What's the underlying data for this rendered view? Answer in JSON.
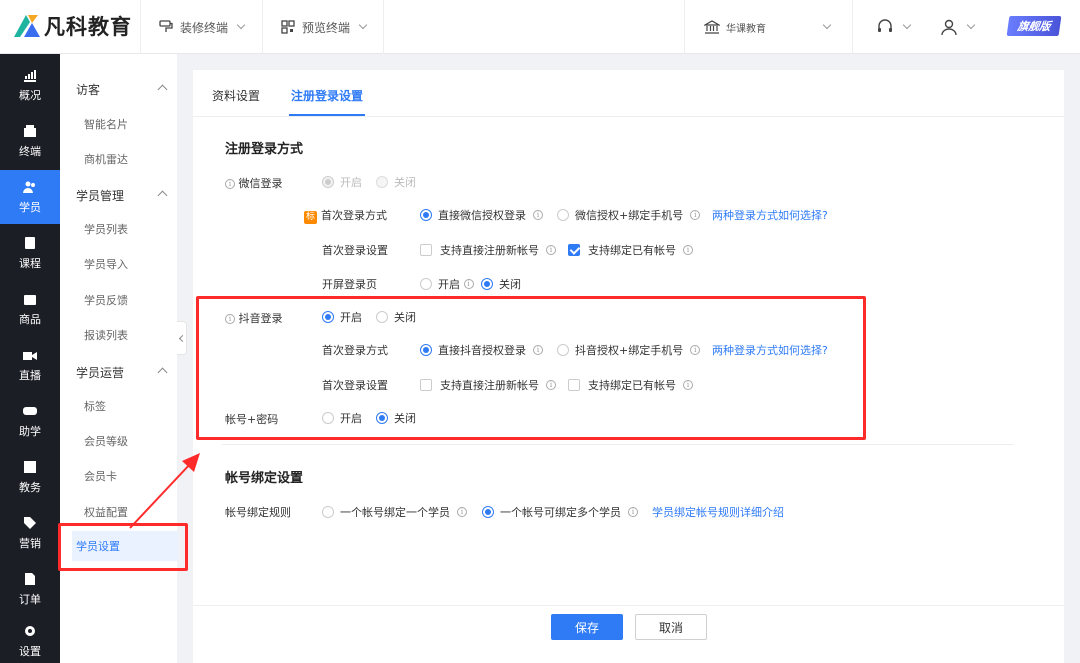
{
  "brand": {
    "name": "凡科教育"
  },
  "topbar": {
    "decorate": "装修终端",
    "preview": "预览终端",
    "org": "华课教育",
    "badge": "旗舰版"
  },
  "leftnav": [
    {
      "label": "概况",
      "icon": "chart-icon"
    },
    {
      "label": "终端",
      "icon": "store-icon"
    },
    {
      "label": "学员",
      "icon": "users-icon",
      "active": true
    },
    {
      "label": "课程",
      "icon": "book-icon"
    },
    {
      "label": "商品",
      "icon": "bag-icon"
    },
    {
      "label": "直播",
      "icon": "video-icon"
    },
    {
      "label": "助学",
      "icon": "gamepad-icon"
    },
    {
      "label": "教务",
      "icon": "bookmark-icon"
    },
    {
      "label": "营销",
      "icon": "tag-icon"
    },
    {
      "label": "订单",
      "icon": "document-icon"
    },
    {
      "label": "设置",
      "icon": "gear-icon"
    }
  ],
  "subnav": {
    "groups": [
      {
        "title": "访客",
        "items": [
          "智能名片",
          "商机雷达"
        ]
      },
      {
        "title": "学员管理",
        "items": [
          "学员列表",
          "学员导入",
          "学员反馈",
          "报读列表"
        ]
      },
      {
        "title": "学员运营",
        "items": [
          "标签",
          "会员等级",
          "会员卡",
          "权益配置",
          "学员设置"
        ]
      }
    ],
    "active": "学员设置"
  },
  "tabs": [
    "资料设置",
    "注册登录设置"
  ],
  "active_tab": "注册登录设置",
  "register": {
    "title": "注册登录方式",
    "wechat": {
      "label": "微信登录",
      "on": "开启",
      "off": "关闭",
      "first_mode_label": "首次登录方式",
      "first_mode_tag": "标",
      "first_mode_opt1": "直接微信授权登录",
      "first_mode_opt2": "微信授权+绑定手机号",
      "help_link": "两种登录方式如何选择?",
      "first_setting_label": "首次登录设置",
      "first_setting_opt1": "支持直接注册新帐号",
      "first_setting_opt2": "支持绑定已有帐号",
      "splash_label": "开屏登录页",
      "splash_on": "开启",
      "splash_off": "关闭"
    },
    "douyin": {
      "label": "抖音登录",
      "on": "开启",
      "off": "关闭",
      "first_mode_label": "首次登录方式",
      "first_mode_opt1": "直接抖音授权登录",
      "first_mode_opt2": "抖音授权+绑定手机号",
      "help_link": "两种登录方式如何选择?",
      "first_setting_label": "首次登录设置",
      "first_setting_opt1": "支持直接注册新帐号",
      "first_setting_opt2": "支持绑定已有帐号"
    },
    "password": {
      "label": "帐号+密码",
      "on": "开启",
      "off": "关闭"
    }
  },
  "binding": {
    "title": "帐号绑定设置",
    "rule_label": "帐号绑定规则",
    "opt1": "一个帐号绑定一个学员",
    "opt2": "一个帐号可绑定多个学员",
    "help_link": "学员绑定帐号规则详细介绍"
  },
  "footer": {
    "save": "保存",
    "cancel": "取消"
  },
  "colors": {
    "accent": "#2f7bf6",
    "nav_bg": "#1c1e26",
    "highlight": "#ff2a2a",
    "tag": "#ff8a00"
  }
}
